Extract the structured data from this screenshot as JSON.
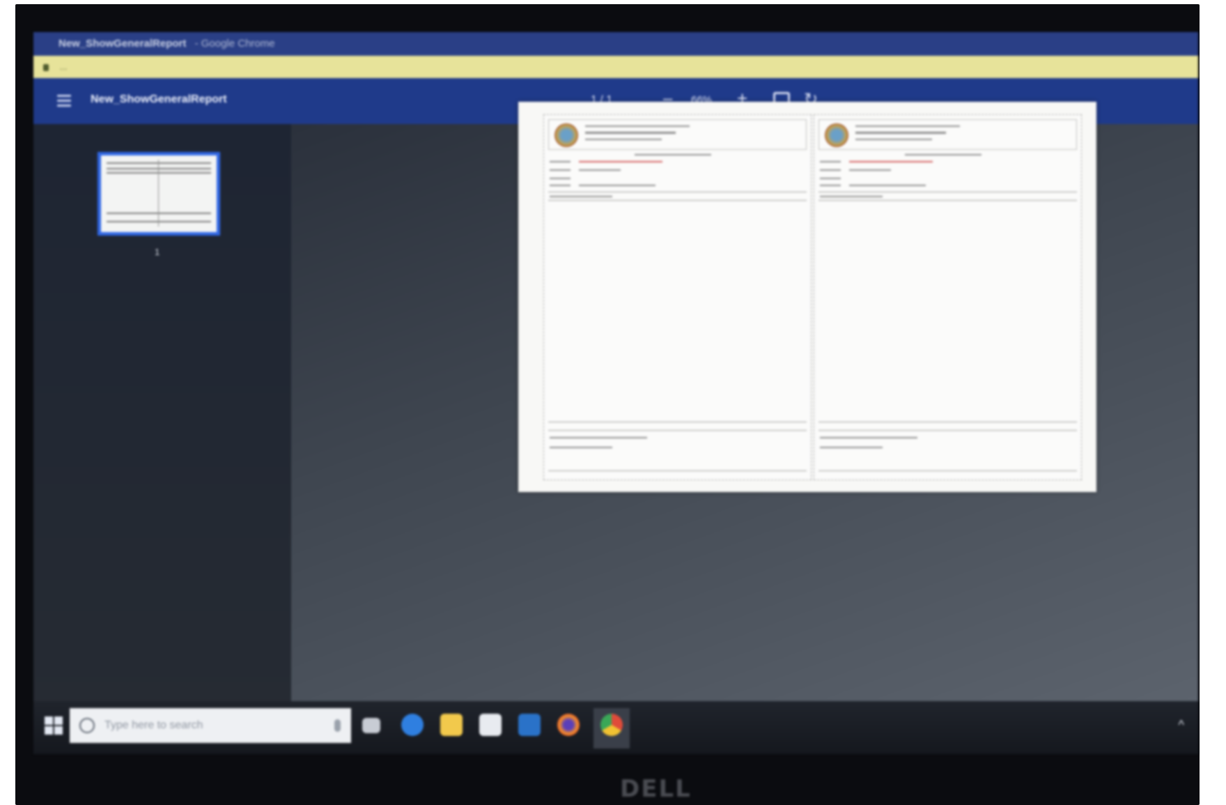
{
  "window": {
    "title": "New_ShowGeneralReport",
    "app_name": "- Google Chrome"
  },
  "address": {
    "url": "..."
  },
  "pdf_toolbar": {
    "document_name": "New_ShowGeneralReport",
    "page_indicator": "1 / 1",
    "zoom_out_label": "–",
    "zoom_level": "66%",
    "zoom_in_label": "+"
  },
  "sidebar": {
    "thumbnail_page_number": "1"
  },
  "taskbar": {
    "search_placeholder": "Type here to search",
    "pinned_apps": [
      "task-view",
      "edge",
      "file-explorer",
      "store",
      "mail",
      "firefox",
      "chrome"
    ],
    "tray_chevron": "^"
  },
  "monitor": {
    "brand": "DELL"
  },
  "colors": {
    "pdf_toolbar": "#1f3a8a",
    "thumbnail_selection": "#3067e5",
    "address_bar": "#e7e39a"
  }
}
